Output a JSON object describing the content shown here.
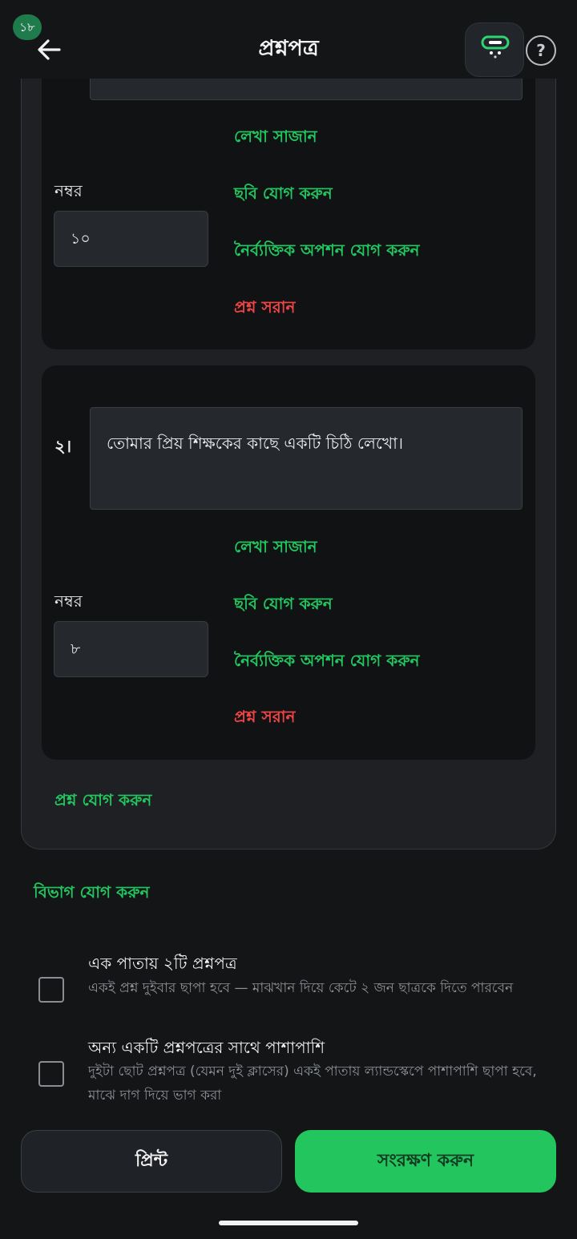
{
  "status": {
    "badge": "১৮"
  },
  "header": {
    "title": "প্রশ্নপত্র",
    "back_icon": "arrow-left-icon",
    "tool_icon": "badge-tool-icon",
    "help_label": "?"
  },
  "section": {
    "question1": {
      "format_label": "লেখা সাজান",
      "marks_label": "নম্বর",
      "marks_value": "১০",
      "add_image_label": "ছবি যোগ করুন",
      "add_mcq_label": "নৈর্ব্যক্তিক অপশন যোগ করুন",
      "remove_label": "প্রশ্ন সরান"
    },
    "question2": {
      "number": "২।",
      "text": "তোমার প্রিয় শিক্ষকের কাছে একটি চিঠি লেখো।",
      "format_label": "লেখা সাজান",
      "marks_label": "নম্বর",
      "marks_value": "৮",
      "add_image_label": "ছবি যোগ করুন",
      "add_mcq_label": "নৈর্ব্যক্তিক অপশন যোগ করুন",
      "remove_label": "প্রশ্ন সরান"
    },
    "add_question_label": "প্রশ্ন যোগ করুন"
  },
  "add_section_label": "বিভাগ যোগ করুন",
  "options": [
    {
      "title": "এক পাতায় ২টি প্রশ্নপত্র",
      "desc": "একই প্রশ্ন দুইবার ছাপা হবে — মাঝখান দিয়ে কেটে ২ জন ছাত্রকে দিতে পারবেন",
      "checked": false
    },
    {
      "title": "অন্য একটি প্রশ্নপত্রের সাথে পাশাপাশি",
      "desc": "দুইটা ছোট প্রশ্নপত্র (যেমন দুই ক্লাসের) একই পাতায় ল্যান্ডস্কেপে পাশাপাশি ছাপা হবে, মাঝে দাগ দিয়ে ভাগ করা",
      "checked": false
    }
  ],
  "footer": {
    "print_label": "প্রিন্ট",
    "save_label": "সংরক্ষণ করুন"
  },
  "colors": {
    "accent_green": "#22c55e",
    "danger_red": "#ef4444",
    "background": "#141517"
  }
}
